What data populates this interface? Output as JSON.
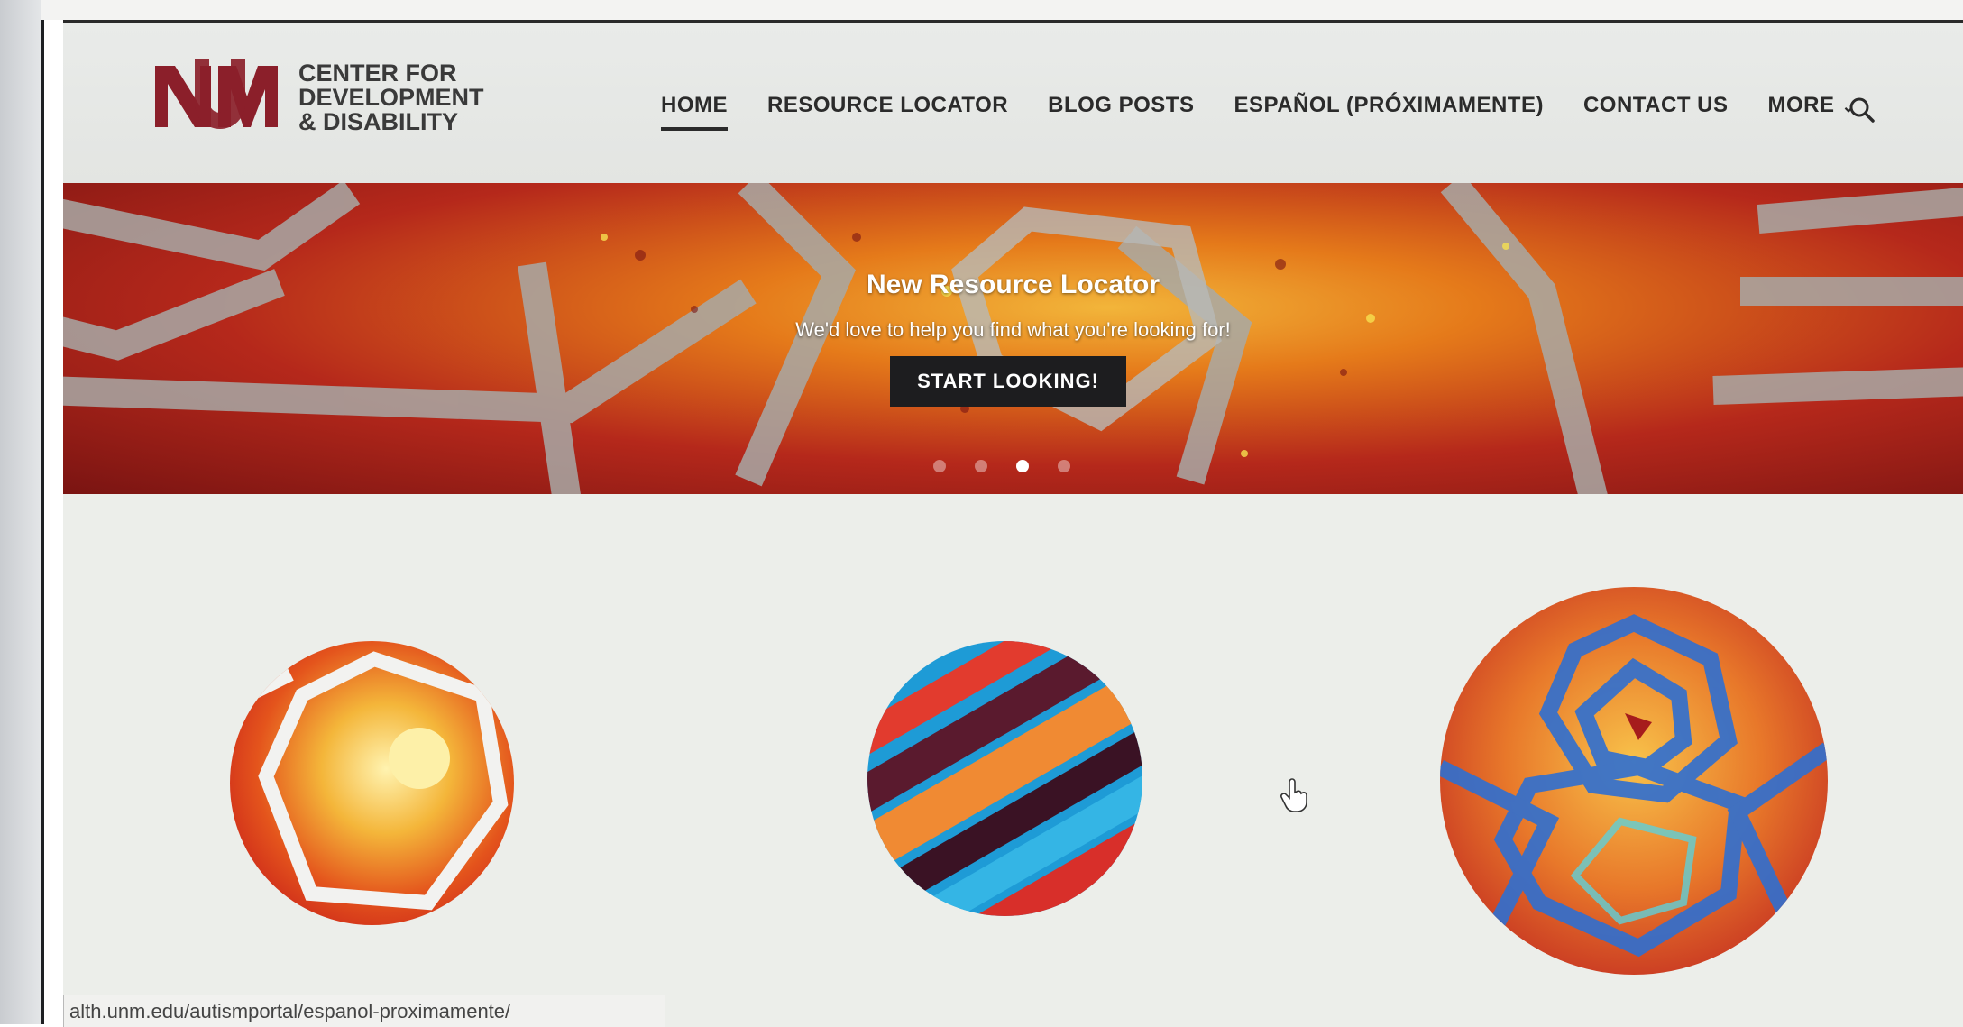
{
  "logo": {
    "lines": [
      "CENTER FOR",
      "DEVELOPMENT",
      "& DISABILITY"
    ],
    "brand_color": "#8b1f2a"
  },
  "nav": {
    "items": [
      "HOME",
      "RESOURCE LOCATOR",
      "BLOG POSTS",
      "ESPAÑOL (PRÓXIMAMENTE)",
      "CONTACT US",
      "MORE"
    ],
    "active": "HOME",
    "search_icon": "search-icon"
  },
  "hero": {
    "title": "New Resource Locator",
    "subtitle": "We'd love to help you find what you're looking for!",
    "button": "START LOOKING!",
    "slides": 4,
    "active_slide": 3
  },
  "status_bar": {
    "url": "alth.unm.edu/autismportal/espanol-proximamente/"
  },
  "colors": {
    "header_bg": "#e6e8e6",
    "hero_red": "#b5281b",
    "hero_orange": "#e57a1a",
    "button_bg": "#1d1d1f"
  }
}
